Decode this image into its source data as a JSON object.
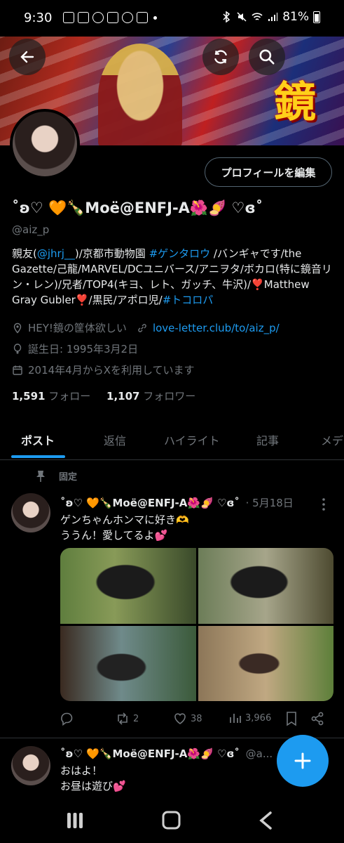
{
  "status_bar": {
    "time": "9:30",
    "battery": "81%",
    "app_icons": [
      "news-icon",
      "news-icon",
      "sync-icon",
      "news-icon",
      "facebook-icon",
      "app-icon"
    ]
  },
  "banner": {
    "logo_text": "鏡"
  },
  "profile": {
    "edit_button": "プロフィールを編集",
    "display_name": "˚ʚ♡ 🧡🍾Moë@ENFJ-A🌺🍠 ♡ɞ˚",
    "handle": "@aiz_p",
    "bio_part1": "親友(",
    "bio_mention": "@jhrj__",
    "bio_part2": ")/京都市動物園 ",
    "bio_hashtag1": "#ゲンタロウ",
    "bio_part3": " /バンギャです/the Gazette/己龍/MARVEL/DCユニバース/アニヲタ/ボカロ(特に鏡音リン・レン)/兄者/TOP4(キヨ、レト、ガッチ、牛沢)/❣️Matthew Gray Gubler❣️/黒民/アポロ児/",
    "bio_hashtag2": "#トコロパ",
    "location": "HEY!鏡の筐体欲しい",
    "website": "love-letter.club/to/aiz_p/",
    "birthday": "誕生日: 1995年3月2日",
    "joined": "2014年4月からXを利用しています",
    "following_count": "1,591",
    "following_label": "フォロー",
    "followers_count": "1,107",
    "followers_label": "フォロワー"
  },
  "tabs": [
    "ポスト",
    "返信",
    "ハイライト",
    "記事",
    "メデ"
  ],
  "pinned_label": "固定",
  "posts": [
    {
      "name": "˚ʚ♡ 🧡🍾Moë@ENFJ-A🌺🍠 ♡ɞ˚",
      "date": "· 5月18日",
      "line1": "ゲンちゃんホンマに好き🫶",
      "line2": "ううん！愛してるよ💕",
      "replies": "",
      "reposts": "2",
      "likes": "38",
      "views": "3,966"
    },
    {
      "name": "˚ʚ♡ 🧡🍾Moë@ENFJ-A🌺🍠 ♡ɞ˚",
      "handle": "@a...",
      "line1": "おはよ！",
      "line2": "お昼は遊び💕"
    }
  ],
  "colors": {
    "accent": "#1d9bf0",
    "muted": "#71767b",
    "text": "#e7e9ea",
    "background": "#000000"
  }
}
